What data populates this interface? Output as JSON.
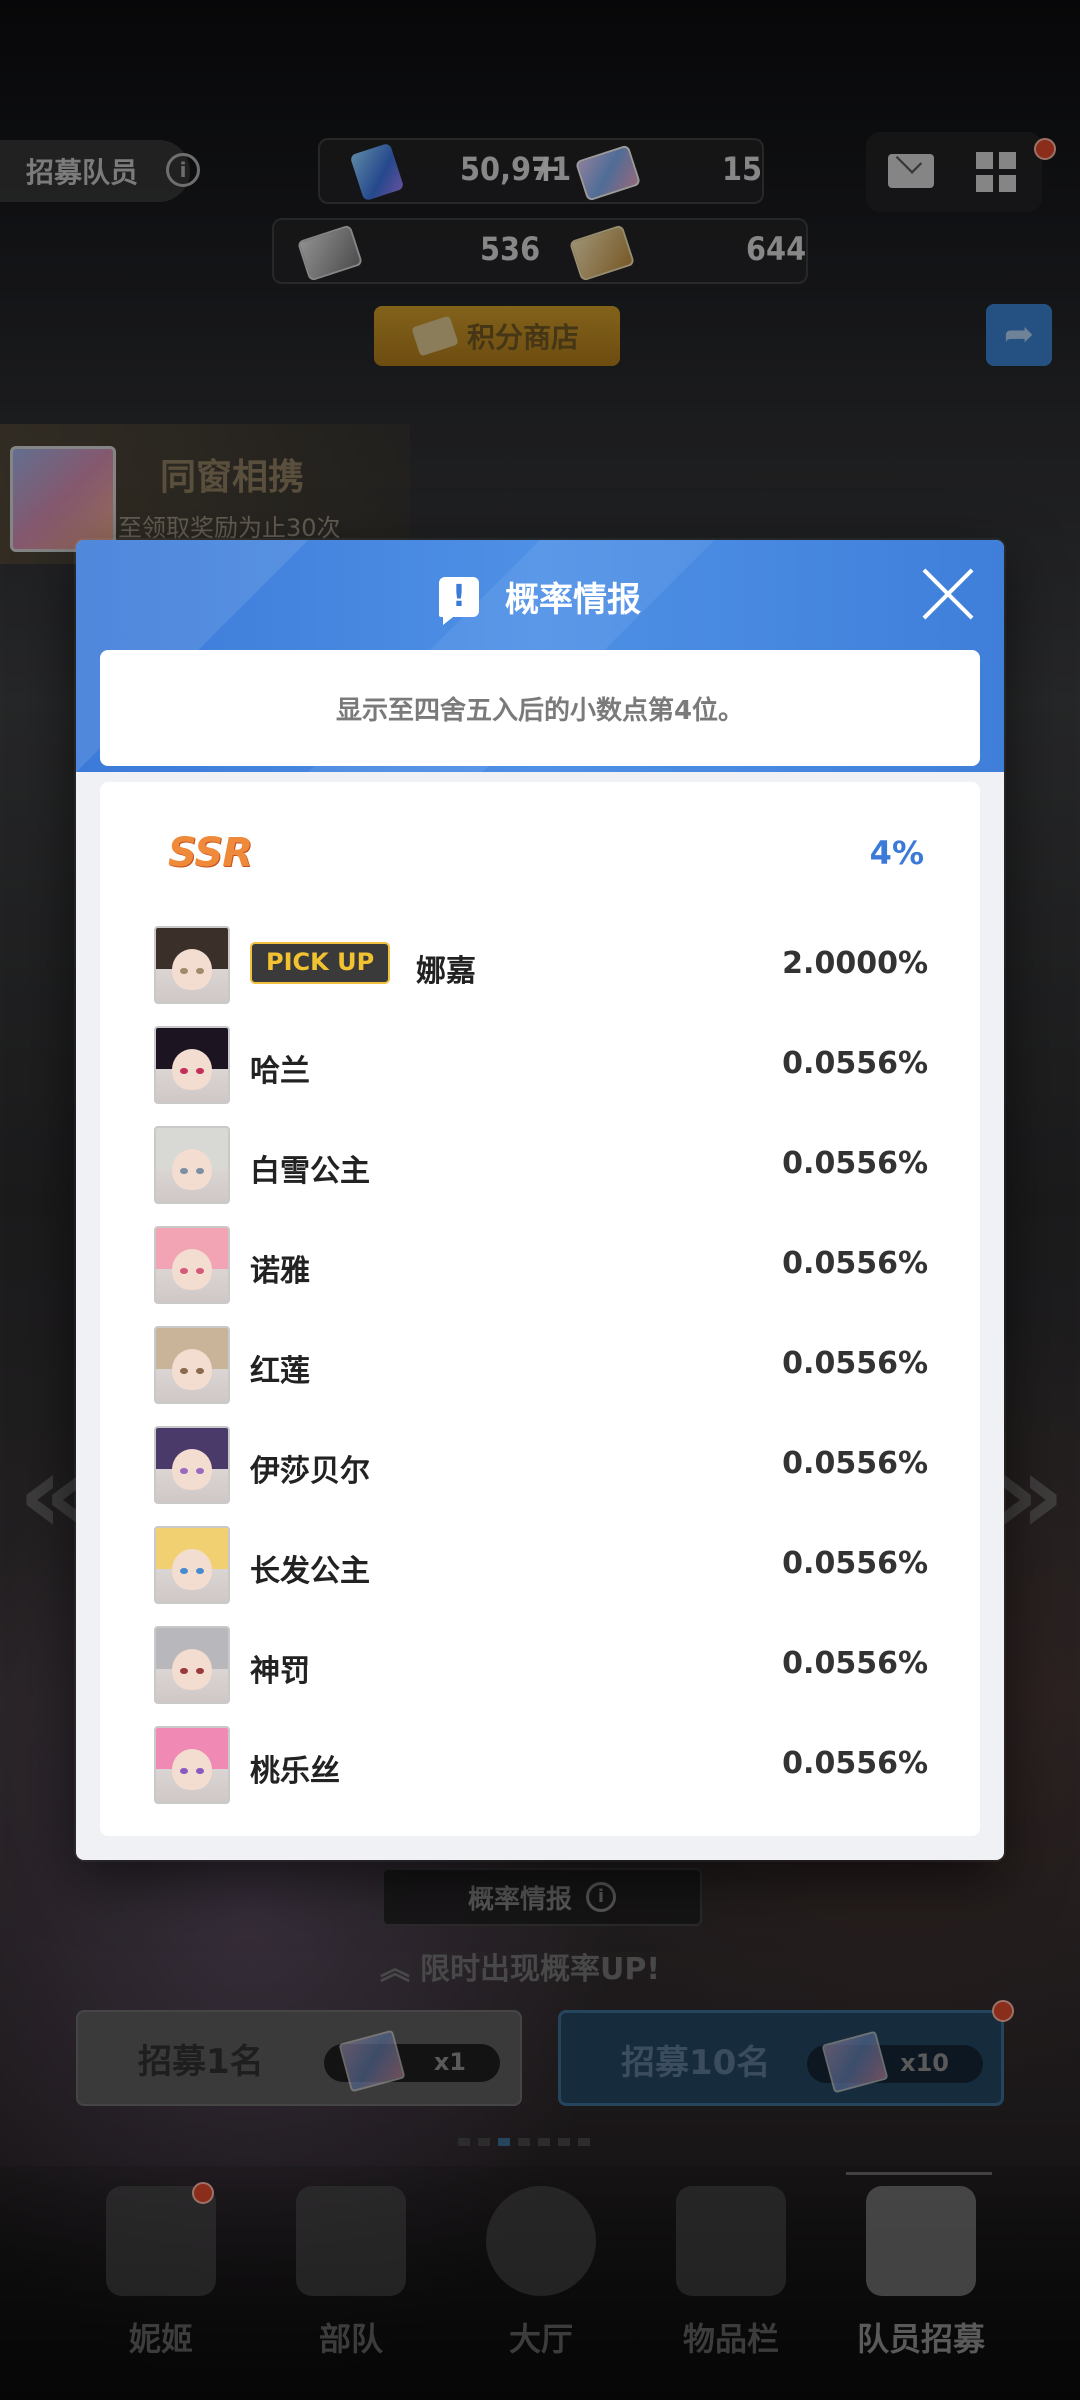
{
  "top": {
    "recruit_tag": "招募队员",
    "currency_1": "50,971",
    "currency_2": "15",
    "currency_3": "536",
    "currency_4": "644",
    "shop_label": "积分商店"
  },
  "banner": {
    "title": "同窗相携",
    "subtitle": "至领取奖励为止30次"
  },
  "modal": {
    "title": "概率情报",
    "notice": "显示至四舍五入后的小数点第4位。",
    "tier": {
      "name": "SSR",
      "rate": "4%"
    },
    "pickup_label": "PICK UP",
    "characters": [
      {
        "name": "娜嘉",
        "rate": "2.0000%",
        "pickup": true,
        "hair": "#3b2f2a",
        "eye": "#a08a6a"
      },
      {
        "name": "哈兰",
        "rate": "0.0556%",
        "pickup": false,
        "hair": "#1c1420",
        "eye": "#c0305a"
      },
      {
        "name": "白雪公主",
        "rate": "0.0556%",
        "pickup": false,
        "hair": "#d8d8d4",
        "eye": "#7a8fa0"
      },
      {
        "name": "诺雅",
        "rate": "0.0556%",
        "pickup": false,
        "hair": "#f2a4b4",
        "eye": "#d45a7a"
      },
      {
        "name": "红莲",
        "rate": "0.0556%",
        "pickup": false,
        "hair": "#c9b49a",
        "eye": "#8a6a4a"
      },
      {
        "name": "伊莎贝尔",
        "rate": "0.0556%",
        "pickup": false,
        "hair": "#4a3a6a",
        "eye": "#9a6ac0"
      },
      {
        "name": "长发公主",
        "rate": "0.0556%",
        "pickup": false,
        "hair": "#f0d070",
        "eye": "#4a8ad0"
      },
      {
        "name": "神罚",
        "rate": "0.0556%",
        "pickup": false,
        "hair": "#b8b8bc",
        "eye": "#9a3a3a"
      },
      {
        "name": "桃乐丝",
        "rate": "0.0556%",
        "pickup": false,
        "hair": "#f08ab4",
        "eye": "#8a5ac0"
      }
    ]
  },
  "bottom": {
    "prob_button": "概率情报",
    "limited_text": "限时出现概率UP!",
    "recruit_1": {
      "label": "招募1名",
      "count": "x1"
    },
    "recruit_10": {
      "label": "招募10名",
      "count": "x10"
    }
  },
  "nav": [
    {
      "label": "妮姬",
      "icon": "nikke-icon"
    },
    {
      "label": "部队",
      "icon": "squad-icon"
    },
    {
      "label": "大厅",
      "icon": "lobby-icon"
    },
    {
      "label": "物品栏",
      "icon": "inventory-icon"
    },
    {
      "label": "队员招募",
      "icon": "recruit-icon"
    }
  ],
  "colors": {
    "accent_blue": "#3b7ad8",
    "ssr_orange": "#ef8a3a",
    "pickup_gold": "#f2c230"
  }
}
